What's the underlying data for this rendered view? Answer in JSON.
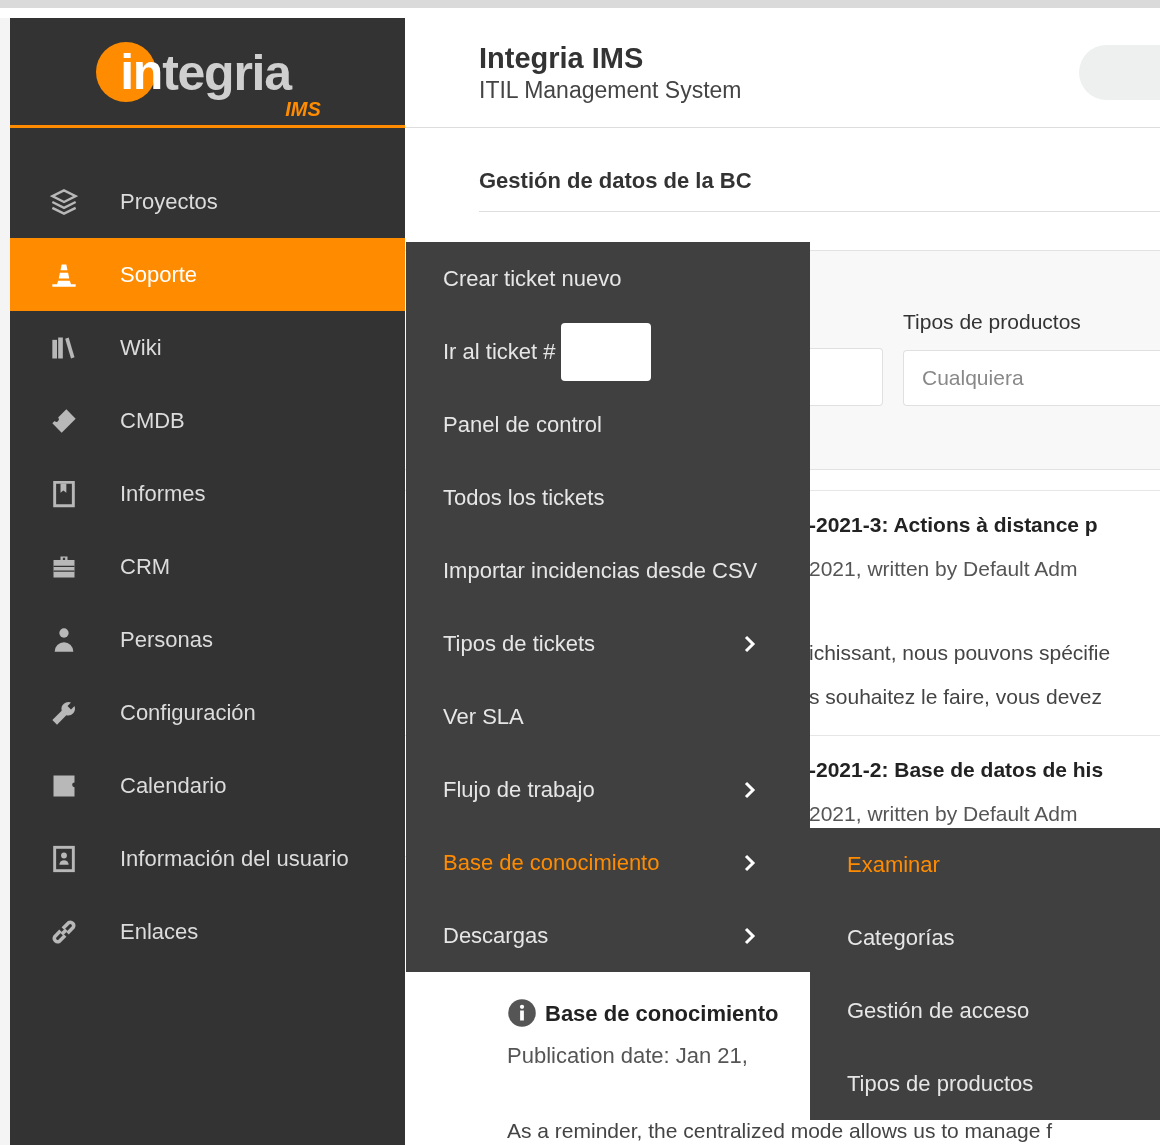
{
  "logo": {
    "mark": "in",
    "word": "tegria",
    "edition": "IMS"
  },
  "header": {
    "title": "Integria IMS",
    "subtitle": "ITIL Management System"
  },
  "sidebar": {
    "items": [
      {
        "label": "Proyectos",
        "selected": false
      },
      {
        "label": "Soporte",
        "selected": true
      },
      {
        "label": "Wiki",
        "selected": false
      },
      {
        "label": "CMDB",
        "selected": false
      },
      {
        "label": "Informes",
        "selected": false
      },
      {
        "label": "CRM",
        "selected": false
      },
      {
        "label": "Personas",
        "selected": false
      },
      {
        "label": "Configuración",
        "selected": false
      },
      {
        "label": "Calendario",
        "selected": false
      },
      {
        "label": "Información del usuario",
        "selected": false
      },
      {
        "label": "Enlaces",
        "selected": false
      }
    ]
  },
  "page_title": "Gestión de datos de la BC",
  "filter": {
    "label": "Tipos de productos",
    "placeholder": "Cualquiera"
  },
  "articles": [
    {
      "title": "-2021-3: Actions à distance p",
      "meta": "2021, written by Default Adm",
      "excerpt": [
        "ichissant, nous pouvons spécifie",
        "s souhaitez le faire, vous devez"
      ]
    },
    {
      "title": "-2021-2: Base de datos de his",
      "meta": "2021, written by Default Adm"
    },
    {
      "title": "Base de conocimiento",
      "meta": "Publication date: Jan 21,",
      "excerpt": [
        "As a reminder, the centralized mode allows us to manage f"
      ]
    }
  ],
  "support_menu": {
    "items": [
      {
        "kind": "link",
        "label": "Crear ticket nuevo",
        "selected": false
      },
      {
        "kind": "input",
        "label": "Ir al ticket #",
        "selected": false
      },
      {
        "kind": "link",
        "label": "Panel de control",
        "selected": false
      },
      {
        "kind": "link",
        "label": "Todos los tickets",
        "selected": false
      },
      {
        "kind": "link",
        "label": "Importar incidencias desde CSV",
        "selected": false
      },
      {
        "kind": "submenu",
        "label": "Tipos de tickets",
        "selected": false
      },
      {
        "kind": "link",
        "label": "Ver SLA",
        "selected": false
      },
      {
        "kind": "submenu",
        "label": "Flujo de trabajo",
        "selected": false
      },
      {
        "kind": "submenu",
        "label": "Base de conocimiento",
        "selected": true
      },
      {
        "kind": "submenu",
        "label": "Descargas",
        "selected": false
      }
    ]
  },
  "kb_menu": {
    "items": [
      {
        "label": "Examinar",
        "selected": true
      },
      {
        "label": "Categorías",
        "selected": false
      },
      {
        "label": "Gestión de acceso",
        "selected": false
      },
      {
        "label": "Tipos de productos",
        "selected": false
      }
    ]
  }
}
